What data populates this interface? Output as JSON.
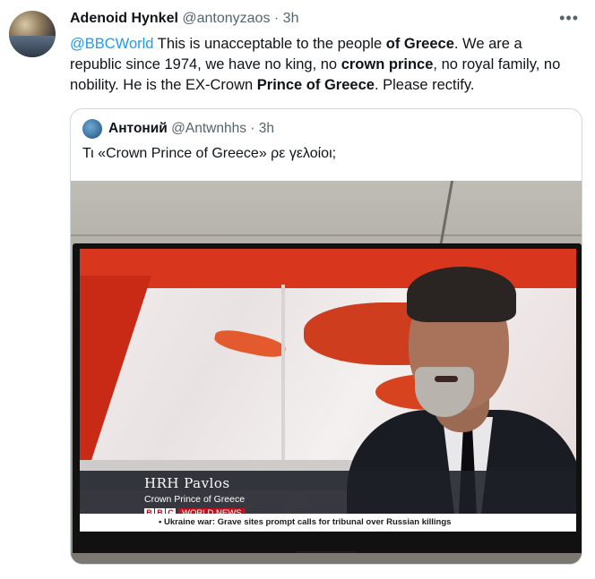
{
  "tweet": {
    "author_name": "Adenoid Hynkel",
    "author_handle": "@antonyzaos",
    "separator": "·",
    "time": "3h",
    "more_label": "•••",
    "body": {
      "mention": "@BBCWorld",
      "t1": " This is unacceptable to the people ",
      "b1": "of Greece",
      "t2": ". We are a republic since 1974, we have no king, no ",
      "b2": "crown prince",
      "t3": ", no royal family, no nobility. He is the EX-Crown ",
      "b3": "Prince of Greece",
      "t4": ". Please rectify."
    }
  },
  "quote": {
    "author_name": "Антоний",
    "author_handle": "@Antwnhhs",
    "separator": "·",
    "time": "3h",
    "text": "Τι «Crown Prince of Greece» ρε γελοίοι;"
  },
  "photo": {
    "caption_name": "HRH Pavlos",
    "caption_title": "Crown Prince of Greece",
    "bbc_letters": [
      "B",
      "B",
      "C"
    ],
    "channel": "WORLD NEWS",
    "ticker": "• Ukraine war: Grave sites prompt calls for tribunal over Russian killings"
  },
  "colors": {
    "link": "#1d9bf0",
    "muted": "#536471",
    "bbc_red": "#c0121f"
  }
}
